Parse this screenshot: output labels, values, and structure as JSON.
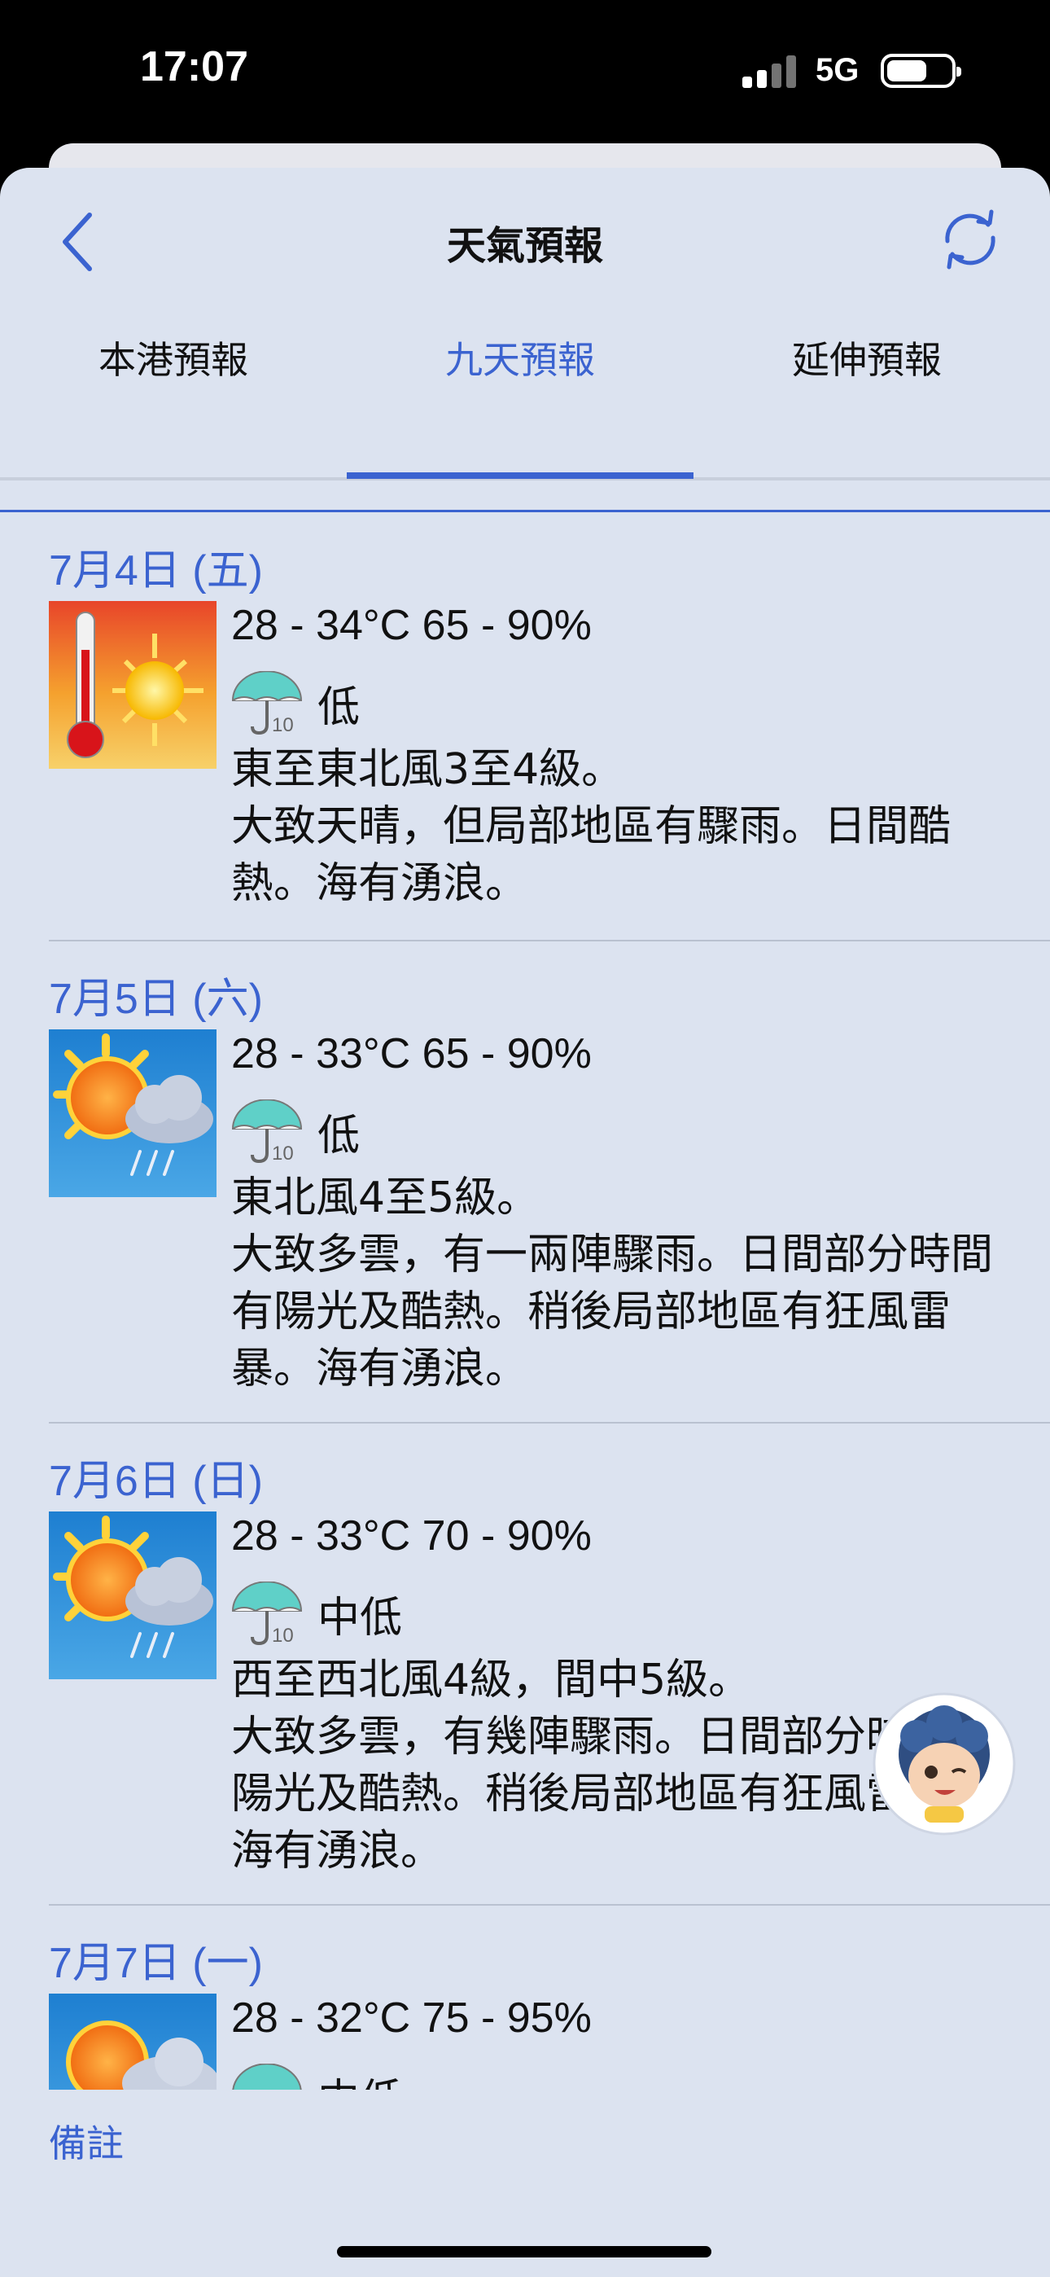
{
  "status_bar": {
    "time": "17:07",
    "network": "5G"
  },
  "nav": {
    "title": "天氣預報",
    "back_icon": "chevron-left-icon",
    "refresh_icon": "refresh-icon"
  },
  "tabs": [
    {
      "label": "本港預報",
      "active": false
    },
    {
      "label": "九天預報",
      "active": true
    },
    {
      "label": "延伸預報",
      "active": false
    }
  ],
  "forecast": [
    {
      "date": "7月4日 (五)",
      "icon": "very-hot-icon",
      "temp": "28 - 34°C  65 - 90%",
      "rain_chance": "低",
      "wind": "東至東北風3至4級。",
      "weather": "大致天晴，但局部地區有驟雨。日間酷熱。海有湧浪。"
    },
    {
      "date": "7月5日 (六)",
      "icon": "sunny-periods-showers-icon",
      "temp": "28 - 33°C  65 - 90%",
      "rain_chance": "低",
      "wind": "東北風4至5級。",
      "weather": "大致多雲，有一兩陣驟雨。日間部分時間有陽光及酷熱。稍後局部地區有狂風雷暴。海有湧浪。"
    },
    {
      "date": "7月6日 (日)",
      "icon": "sunny-periods-showers-icon",
      "temp": "28 - 33°C  70 - 90%",
      "rain_chance": "中低",
      "wind": "西至西北風4級，間中5級。",
      "weather": "大致多雲，有幾陣驟雨。日間部分時間有陽光及酷熱。稍後局部地區有狂風雷暴。海有湧浪。"
    },
    {
      "date": "7月7日 (一)",
      "icon": "sunny-periods-icon",
      "temp": "28 - 32°C  75 - 95%",
      "rain_chance": "中低",
      "wind": "",
      "weather": ""
    }
  ],
  "footer": {
    "notes_label": "備註"
  }
}
